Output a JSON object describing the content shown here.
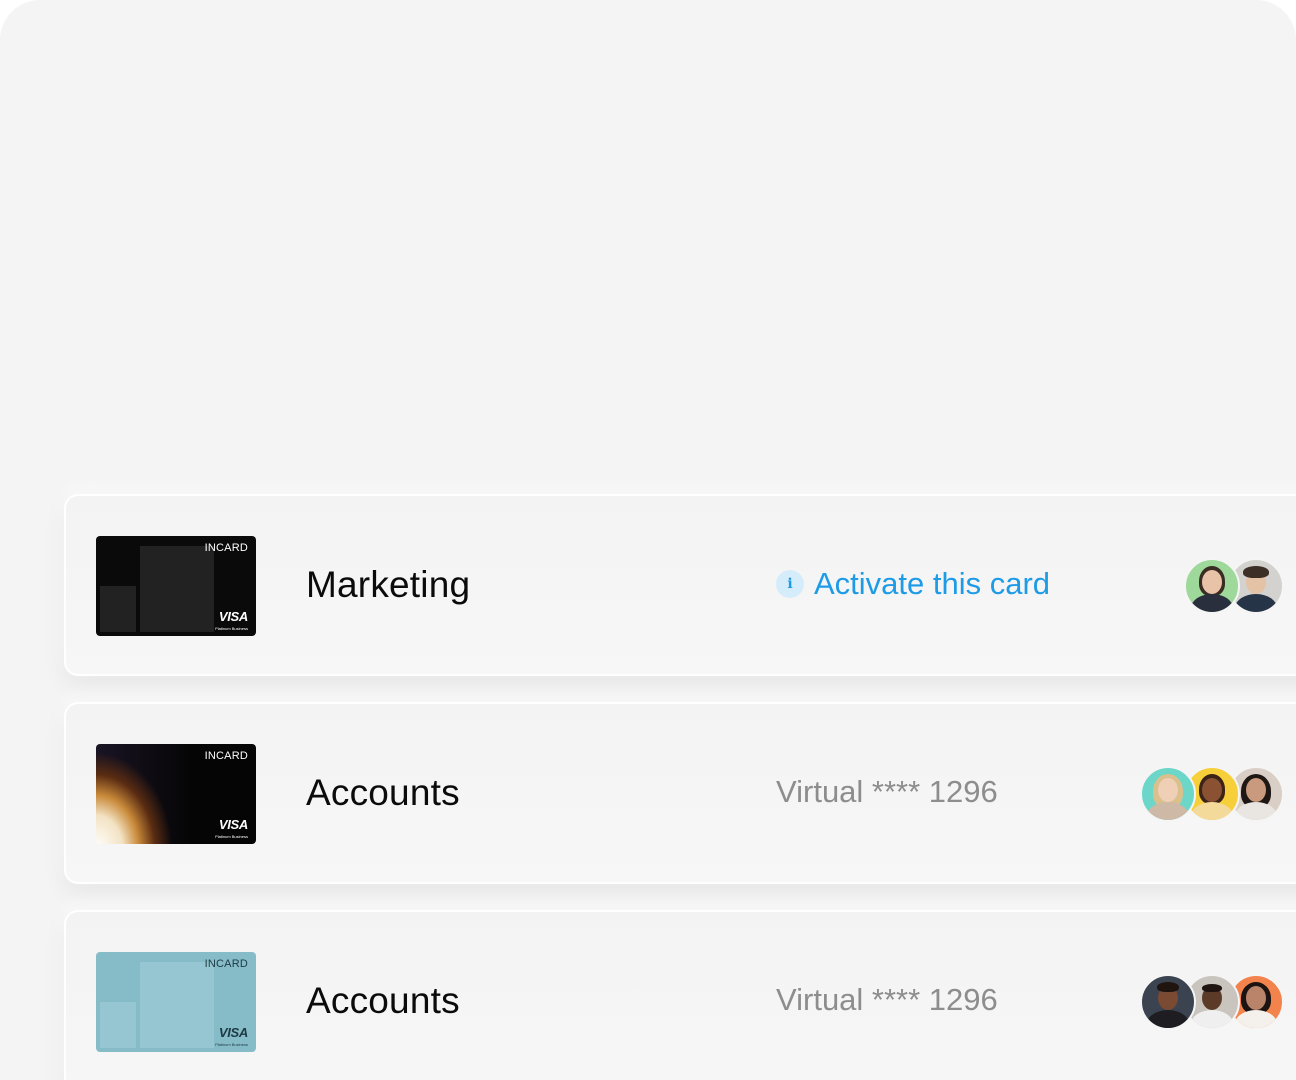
{
  "rows": [
    {
      "title": "Marketing",
      "activate_label": "Activate this card",
      "card": {
        "brand": "INCARD",
        "network": "VISA",
        "tier": "Platinum Business",
        "style": "black"
      },
      "avatars": [
        {
          "name": "avatar-woman-green",
          "bg": "#9ed89a"
        },
        {
          "name": "avatar-man-grey",
          "bg": "#d4d2cf"
        }
      ]
    },
    {
      "title": "Accounts",
      "status": "Virtual **** 1296",
      "card": {
        "brand": "INCARD",
        "network": "VISA",
        "tier": "Platinum Business",
        "style": "gradient"
      },
      "avatars": [
        {
          "name": "avatar-woman-teal",
          "bg": "#6cd6c8"
        },
        {
          "name": "avatar-woman-yellow",
          "bg": "#f7cf3b"
        },
        {
          "name": "avatar-woman-beige",
          "bg": "#d9cfc6"
        }
      ]
    },
    {
      "title": "Accounts",
      "status": "Virtual **** 1296",
      "card": {
        "brand": "INCARD",
        "network": "VISA",
        "tier": "Platinum Business",
        "style": "teal"
      },
      "avatars": [
        {
          "name": "avatar-man-dark",
          "bg": "#3b4350"
        },
        {
          "name": "avatar-man-light",
          "bg": "#c9c4bd"
        },
        {
          "name": "avatar-woman-orange",
          "bg": "#f3834d"
        }
      ]
    }
  ],
  "colors": {
    "accent": "#1e9be6",
    "muted_text": "#8d8d8d",
    "panel_bg": "#f4f4f4"
  },
  "icons": {
    "info": "info-icon"
  }
}
